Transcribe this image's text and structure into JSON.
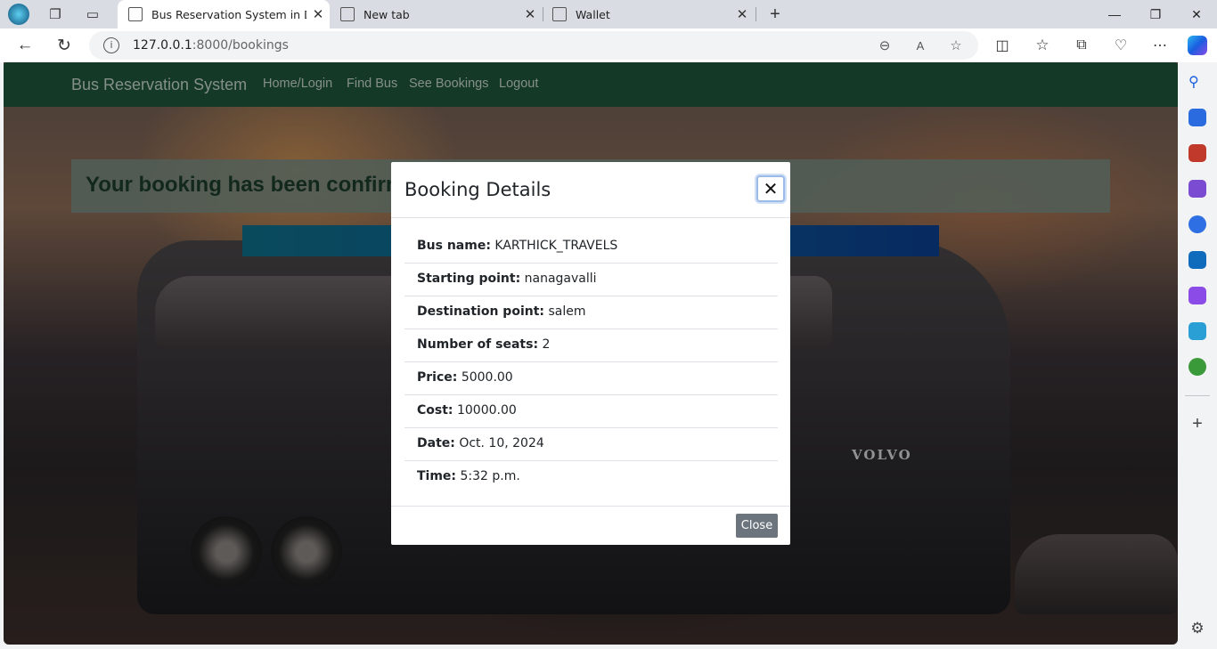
{
  "browser": {
    "tabs": [
      {
        "title": "Bus Reservation System in Djang",
        "active": true
      },
      {
        "title": "New tab",
        "active": false
      },
      {
        "title": "Wallet",
        "active": false
      }
    ],
    "url_host": "127.0.0.1",
    "url_path": ":8000/bookings"
  },
  "site": {
    "brand": "Bus Reservation System",
    "nav": [
      "Home/Login",
      "Find Bus",
      "See Bookings",
      "Logout"
    ],
    "alert": "Your booking has been confirmed",
    "bus_badge": "VOLVO"
  },
  "modal": {
    "title": "Booking Details",
    "close_label": "Close",
    "details": [
      {
        "label": "Bus name:",
        "value": "KARTHICK_TRAVELS"
      },
      {
        "label": "Starting point:",
        "value": "nanagavalli"
      },
      {
        "label": "Destination point:",
        "value": "salem"
      },
      {
        "label": "Number of seats:",
        "value": "2"
      },
      {
        "label": "Price:",
        "value": "5000.00"
      },
      {
        "label": "Cost:",
        "value": "10000.00"
      },
      {
        "label": "Date:",
        "value": "Oct. 10, 2024"
      },
      {
        "label": "Time:",
        "value": "5:32 p.m."
      }
    ]
  },
  "colors": {
    "navbar": "#1e553a",
    "close_button": "#6c757d"
  }
}
